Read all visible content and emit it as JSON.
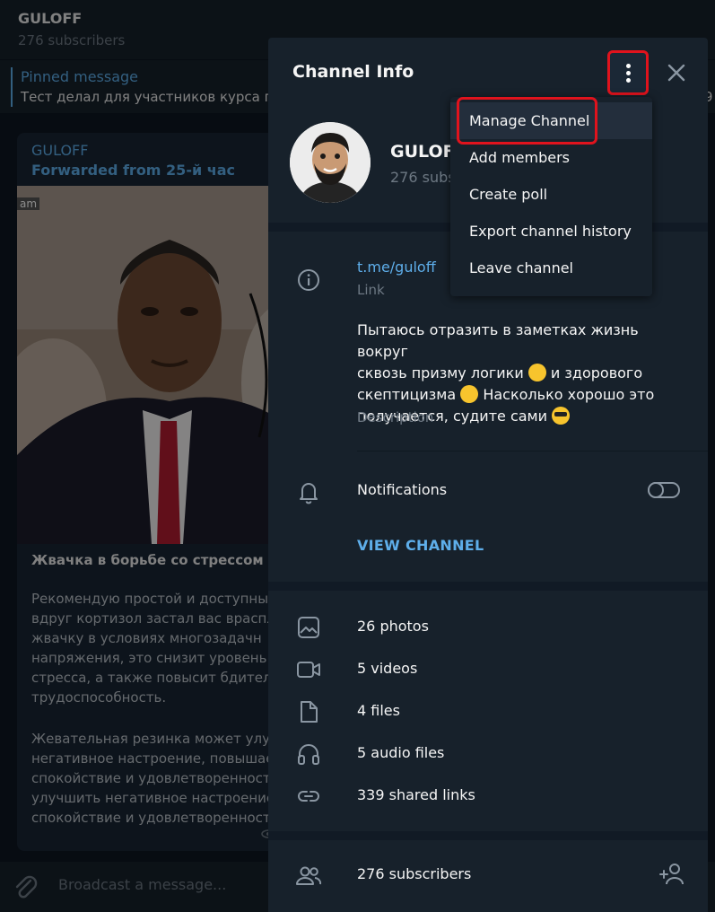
{
  "chat": {
    "title": "GULOFF",
    "subscribers": "276 subscribers",
    "pinned_title": "Pinned message",
    "pinned_text": "Тест делал для участников курса по",
    "pinned_extra": "9",
    "message": {
      "author": "GULOFF",
      "forwarded": "Forwarded from 25-й час",
      "photo_tag": "am",
      "heading": "Жвачка в борьбе со стрессом",
      "body": "Рекомендую простой и доступный\nвдруг кортизол застал вас врасплох\nжвачку в условиях многозадачн\nнапряжения, это снизит уровень\nстресса, а также повысит бдител\nтрудоспособность.",
      "body2": "Жевательная резинка может улуч\nнегативное настроение, повышае\nспокойствие и удовлетворенност\nулучшить негативное настроение\nспокойствие и удовлетворенност"
    },
    "composer_placeholder": "Broadcast a message..."
  },
  "panel": {
    "title": "Channel Info",
    "channel_name": "GULOFF",
    "channel_subs": "276 subs",
    "link": "t.me/guloff",
    "link_label": "Link",
    "description_lines": [
      "Пытаюсь отразить в заметках жизнь вокруг",
      "сквозь призму логики",
      "и здорового",
      "скептицизма",
      "Насколько хорошо это",
      "получается, судите сами"
    ],
    "description_label": "Description",
    "notifications_label": "Notifications",
    "notifications_on": false,
    "view_channel": "VIEW CHANNEL",
    "media": [
      {
        "label": "26 photos",
        "icon": "photo-icon"
      },
      {
        "label": "5 videos",
        "icon": "video-icon"
      },
      {
        "label": "4 files",
        "icon": "file-icon"
      },
      {
        "label": "5 audio files",
        "icon": "headphones-icon"
      },
      {
        "label": "339 shared links",
        "icon": "link-icon"
      }
    ],
    "subscribers_label": "276 subscribers"
  },
  "menu": {
    "items": [
      "Manage Channel",
      "Add members",
      "Create poll",
      "Export channel history",
      "Leave channel"
    ],
    "active_index": 0
  },
  "colors": {
    "accent": "#5eaeea",
    "highlight": "#e0131d",
    "panel_bg": "#17212b"
  }
}
